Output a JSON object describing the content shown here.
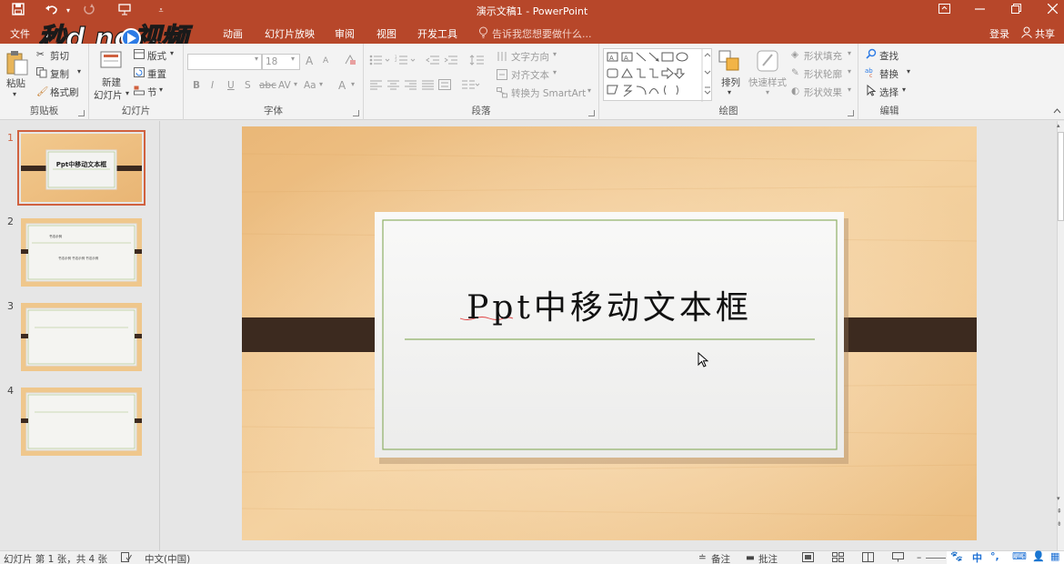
{
  "window": {
    "title": "演示文稿1 - PowerPoint"
  },
  "tabs": {
    "file": "文件",
    "animations": "动画",
    "slideshow": "幻灯片放映",
    "review": "审阅",
    "view": "视图",
    "developer": "开发工具",
    "tell_me": "告诉我您想要做什么...",
    "login": "登录",
    "share": "共享"
  },
  "ribbon": {
    "clipboard": {
      "paste": "粘贴",
      "cut": "剪切",
      "copy": "复制",
      "format_painter": "格式刷",
      "label": "剪贴板"
    },
    "slides": {
      "new_slide_line1": "新建",
      "new_slide_line2": "幻灯片",
      "layout": "版式",
      "reset": "重置",
      "section": "节",
      "label": "幻灯片"
    },
    "font": {
      "size": "18",
      "bold": "B",
      "italic": "I",
      "underline": "U",
      "shadow": "S",
      "strike": "abc",
      "spacing": "AV",
      "case": "Aa",
      "color": "A",
      "grow": "A",
      "shrink": "A",
      "label": "字体"
    },
    "paragraph": {
      "text_direction": "文字方向",
      "align_text": "对齐文本",
      "smartart": "转换为 SmartArt",
      "label": "段落"
    },
    "drawing": {
      "arrange": "排列",
      "quick_styles": "快速样式",
      "shape_fill": "形状填充",
      "shape_outline": "形状轮廓",
      "shape_effects": "形状效果",
      "label": "绘图"
    },
    "editing": {
      "find": "查找",
      "replace": "替换",
      "select": "选择",
      "label": "编辑"
    }
  },
  "thumbnails": [
    {
      "number": "1",
      "title": "Ppt中移动文本框"
    },
    {
      "number": "2",
      "title": "书法示例",
      "body": "书法示例 书法示例 书法示例"
    },
    {
      "number": "3"
    },
    {
      "number": "4"
    }
  ],
  "slide": {
    "title": "Ppt中移动文本框"
  },
  "status": {
    "slide_info": "幻灯片 第 1 张，共 4 张",
    "language": "中文(中国)",
    "notes": "备注",
    "comments": "批注"
  },
  "ime": {
    "zh": "中"
  },
  "watermark": {
    "text": "秒懂视频"
  },
  "colors": {
    "accent": "#b7472a",
    "bar": "#3c2a1f",
    "line": "#8fb067"
  }
}
